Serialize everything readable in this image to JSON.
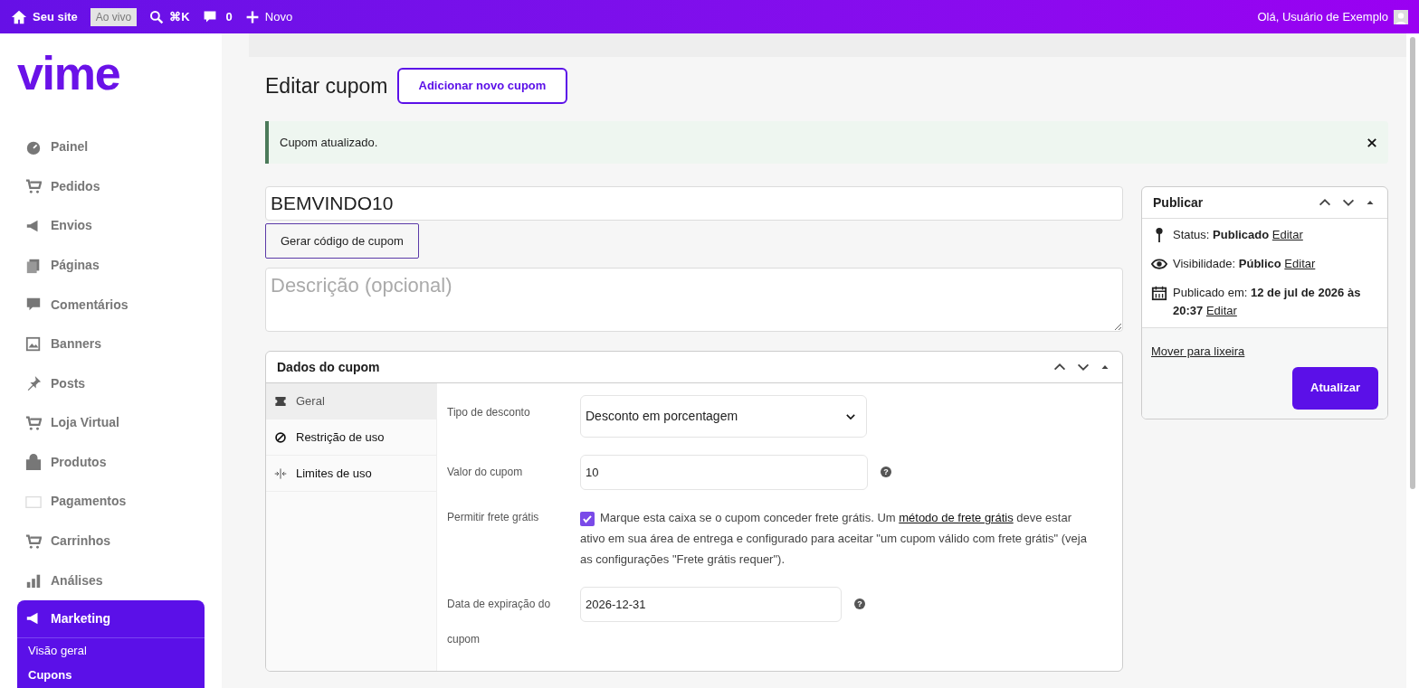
{
  "top_bar": {
    "site": "Seu site",
    "live_badge": "Ao vivo",
    "search_shortcut": "⌘K",
    "comments_count": "0",
    "new": "Novo",
    "greeting": "Olá, Usuário de Exemplo"
  },
  "logo": "vime",
  "sidebar": {
    "items": [
      {
        "label": "Painel",
        "selected": false
      },
      {
        "label": "Pedidos",
        "selected": false
      },
      {
        "label": "Envios",
        "selected": false
      },
      {
        "label": "Páginas",
        "selected": false
      },
      {
        "label": "Comentários",
        "selected": false
      },
      {
        "label": "Banners",
        "selected": false
      },
      {
        "label": "Posts",
        "selected": false
      },
      {
        "label": "Loja Virtual",
        "selected": false
      },
      {
        "label": "Produtos",
        "selected": false
      },
      {
        "label": "Pagamentos",
        "selected": false
      },
      {
        "label": "Carrinhos",
        "selected": false
      },
      {
        "label": "Análises",
        "selected": false
      },
      {
        "label": "Marketing",
        "selected": true,
        "children": [
          {
            "label": "Visão geral",
            "selected": false
          },
          {
            "label": "Cupons",
            "selected": true
          }
        ]
      }
    ]
  },
  "page": {
    "title": "Editar cupom",
    "add_button": "Adicionar novo cupom"
  },
  "notice": {
    "text": "Cupom atualizado."
  },
  "coupon_code": "BEMVINDO10",
  "generate_button": "Gerar código de cupom",
  "description": {
    "placeholder": "Descrição (opcional)"
  },
  "coupon_data": {
    "title": "Dados do cupom",
    "tabs": [
      {
        "label": "Geral",
        "selected": true
      },
      {
        "label": "Restrição de uso",
        "selected": false
      },
      {
        "label": "Limites de uso",
        "selected": false
      }
    ],
    "fields": [
      {
        "kind": "select",
        "label": "Tipo de desconto",
        "value": "Desconto em porcentagem"
      },
      {
        "kind": "text",
        "label": "Valor do cupom",
        "value": "10",
        "help": "?"
      },
      {
        "kind": "checkbox",
        "label": "Permitir frete grátis",
        "checked": true,
        "text_before": "Marque esta caixa se o cupom conceder frete grátis. Um",
        "link": "método de frete grátis",
        "text_after": "deve estar ativo em sua área de entrega e configurado para aceitar \"um cupom válido com frete grátis\" (veja as configurações \"Frete grátis requer\")."
      },
      {
        "kind": "date",
        "label": "Data de expiração do cupom",
        "value": "2026-12-31",
        "help": "?"
      }
    ]
  },
  "publish": {
    "title": "Publicar",
    "rows": [
      {
        "label": "Status:",
        "value": "Publicado",
        "link": "Editar"
      },
      {
        "label": "Visibilidade:",
        "value": "Público",
        "link": "Editar"
      },
      {
        "label": "Publicado em:",
        "value": "12 de jul de 2026 às 20:37",
        "link": "Editar"
      }
    ],
    "trash_link": "Mover para lixeira",
    "update_button": "Atualizar"
  }
}
